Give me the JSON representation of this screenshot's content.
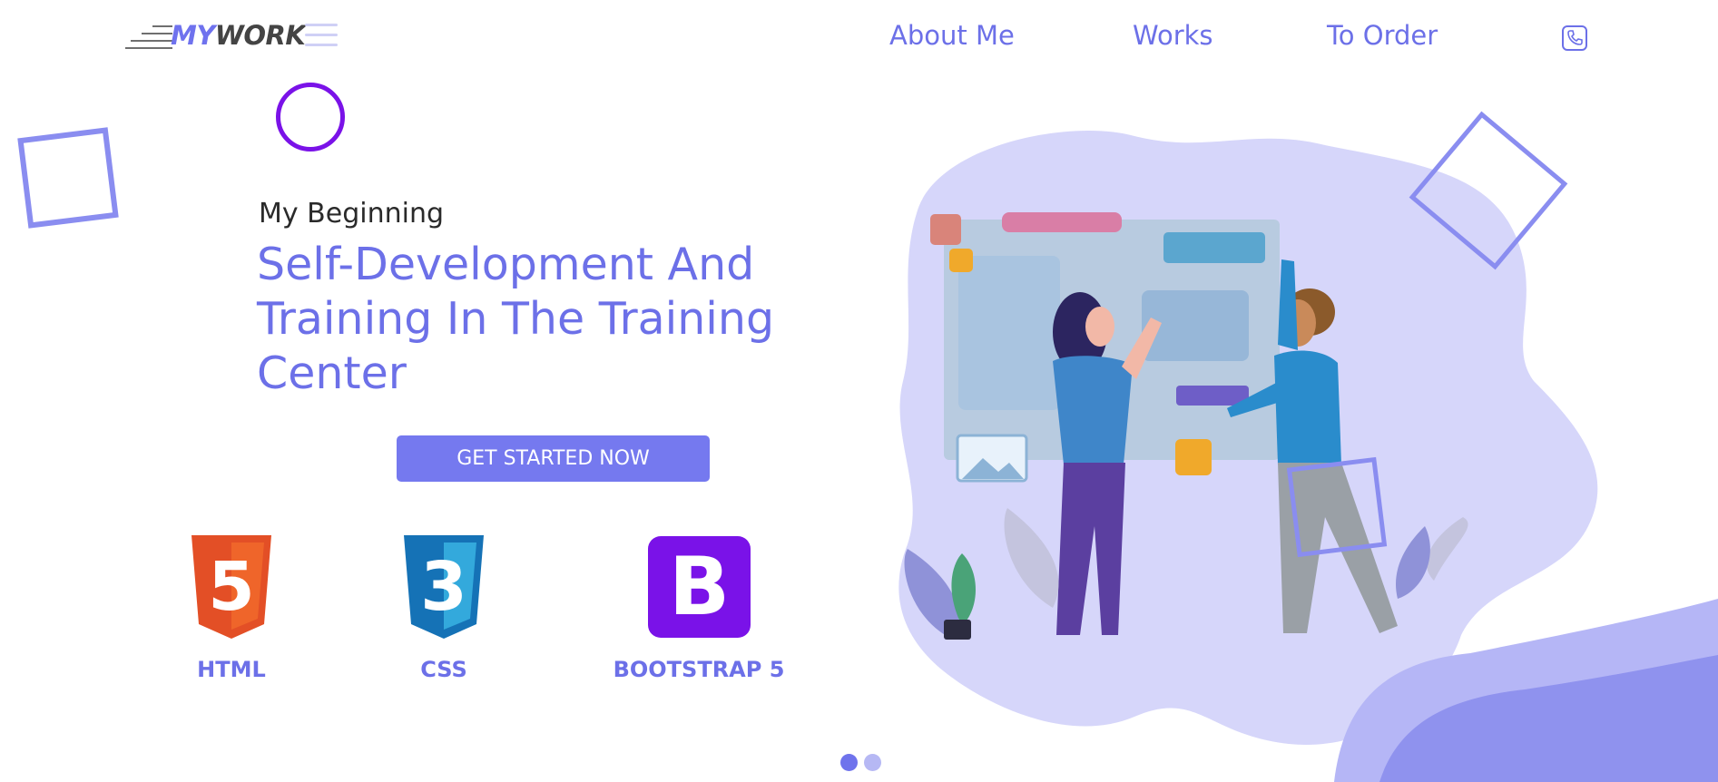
{
  "header": {
    "logo": {
      "part1": "MY",
      "part2": "WORK"
    },
    "nav": [
      {
        "label": "About Me"
      },
      {
        "label": "Works"
      },
      {
        "label": "To Order"
      }
    ],
    "phone_icon": "phone-icon",
    "menu_icon": "hamburger-icon"
  },
  "hero": {
    "subtitle": "My Beginning",
    "headline": "Self-Development And Training In The Training Center",
    "cta_label": "GET STARTED NOW"
  },
  "tech": [
    {
      "label": "HTML",
      "icon": "html5-icon",
      "badge": "5"
    },
    {
      "label": "CSS",
      "icon": "css3-icon",
      "badge": "3"
    },
    {
      "label": "BOOTSTRAP 5",
      "icon": "bootstrap-icon",
      "badge": "B"
    }
  ],
  "carousel": {
    "slides": 2,
    "active": 1
  },
  "colors": {
    "accent": "#6c70e8",
    "button": "#7579ef",
    "purple": "#7a12e8",
    "html_orange": "#e34f26",
    "css_blue": "#1572b6",
    "blob": "#d6d6fa"
  }
}
